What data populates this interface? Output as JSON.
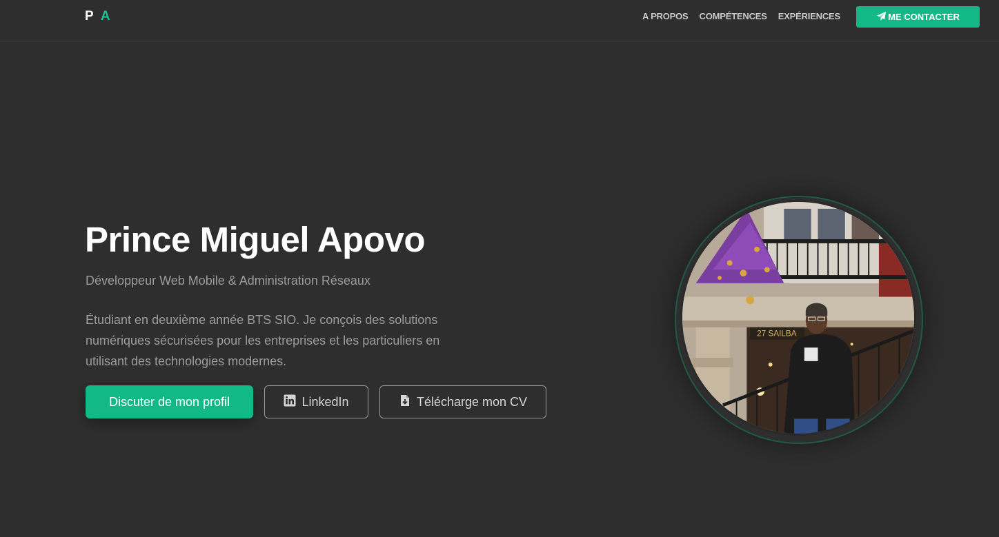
{
  "nav": {
    "logo_first": "P",
    "logo_second": "A",
    "links": [
      "A PROPOS",
      "COMPÉTENCES",
      "EXPÉRIENCES"
    ],
    "contact_label": "ME CONTACTER",
    "contact_icon": "paper-plane-icon"
  },
  "hero": {
    "name": "Prince Miguel Apovo",
    "title": "Développeur Web Mobile & Administration Réseaux",
    "description": "Étudiant en deuxième année BTS SIO. Je conçois des solutions numériques sécurisées pour les entreprises et les particuliers en utilisant des technologies modernes.",
    "buttons": {
      "primary": "Discuter de mon profil",
      "linkedin": "LinkedIn",
      "linkedin_icon": "linkedin-icon",
      "cv": "Télécharge mon CV",
      "cv_icon": "file-download-icon"
    },
    "photo_sign_text": "27 SAILBA"
  },
  "colors": {
    "background": "#2e2e2e",
    "accent": "#12b886",
    "text_muted": "#9c9c9c"
  }
}
